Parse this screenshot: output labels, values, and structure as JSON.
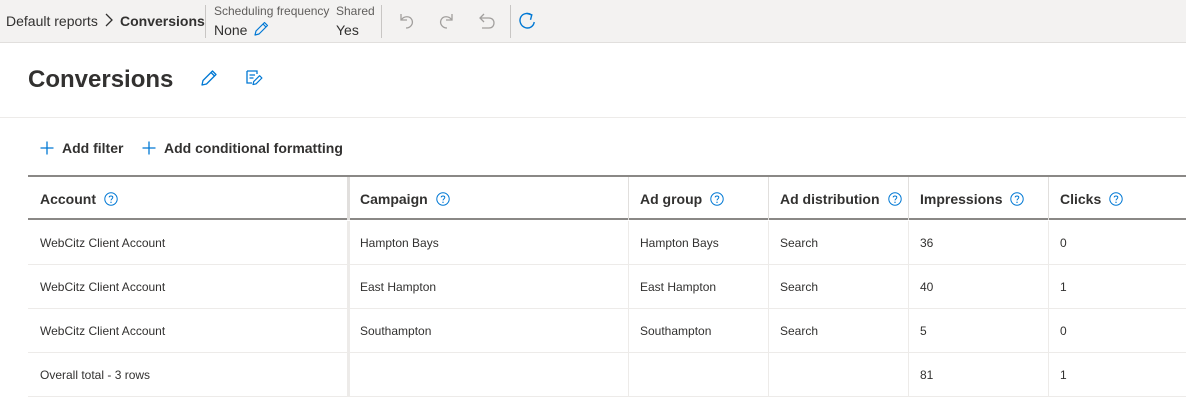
{
  "breadcrumb": {
    "root": "Default reports",
    "current": "Conversions"
  },
  "toolbar": {
    "scheduling_label": "Scheduling frequency",
    "scheduling_value": "None",
    "shared_label": "Shared",
    "shared_value": "Yes",
    "icons": [
      "undo-icon",
      "redo-icon",
      "revert-icon",
      "refresh-icon"
    ]
  },
  "page": {
    "title": "Conversions",
    "icons": [
      "edit-icon",
      "save-as-icon"
    ]
  },
  "actions": {
    "add_filter": "Add filter",
    "add_formatting": "Add conditional formatting"
  },
  "table": {
    "columns": [
      "Account",
      "Campaign",
      "Ad group",
      "Ad distribution",
      "Impressions",
      "Clicks"
    ],
    "rows": [
      [
        "WebCitz Client Account",
        "Hampton Bays",
        "Hampton Bays",
        "Search",
        "36",
        "0"
      ],
      [
        "WebCitz Client Account",
        "East Hampton",
        "East Hampton",
        "Search",
        "40",
        "1"
      ],
      [
        "WebCitz Client Account",
        "Southampton",
        "Southampton",
        "Search",
        "5",
        "0"
      ]
    ],
    "total": [
      "Overall total - 3 rows",
      "",
      "",
      "",
      "81",
      "1"
    ]
  },
  "colors": {
    "accent": "#0078d4",
    "text": "#323130",
    "toolbar_bg": "#f3f2f1"
  }
}
